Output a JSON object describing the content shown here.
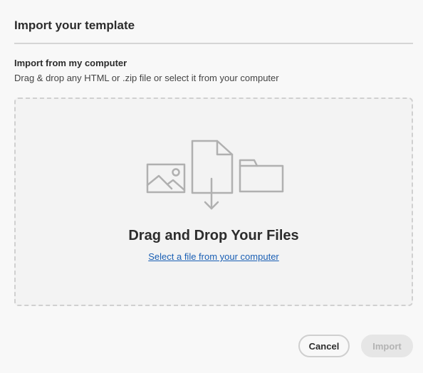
{
  "dialog": {
    "title": "Import your template"
  },
  "section": {
    "heading": "Import from my computer",
    "description": "Drag & drop any HTML or .zip file or select it from your computer"
  },
  "dropzone": {
    "title": "Drag and Drop Your Files",
    "link_label": "Select a file from your computer",
    "icons": [
      "image-icon",
      "file-download-icon",
      "folder-icon"
    ]
  },
  "buttons": {
    "cancel_label": "Cancel",
    "import_label": "Import",
    "import_disabled": true
  },
  "colors": {
    "link": "#1a5fb4",
    "illustration": "#b0b0b0",
    "dropzone_border": "#d0d0d0"
  }
}
